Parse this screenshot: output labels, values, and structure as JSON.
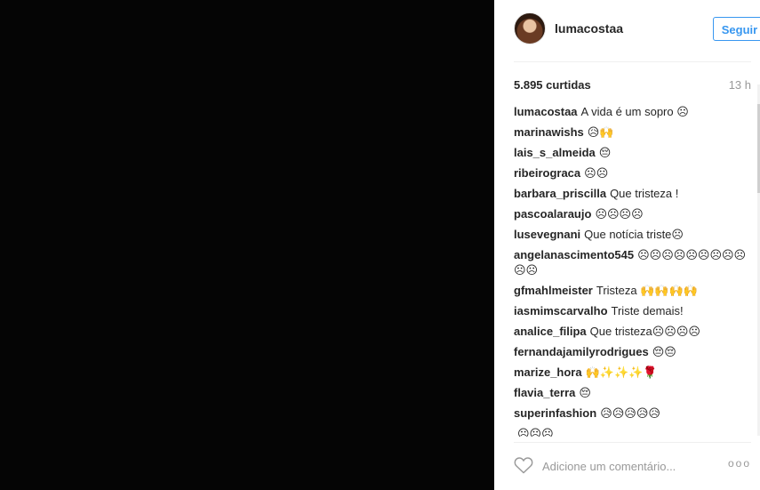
{
  "post": {
    "username": "lumacostaa",
    "follow_label": "Seguir",
    "likes": "5.895 curtidas",
    "time": "13 h"
  },
  "comments": [
    {
      "user": "lumacostaa",
      "text": "A vida é um sopro ☹"
    },
    {
      "user": "marinawishs",
      "text": "😥🙌"
    },
    {
      "user": "lais_s_almeida",
      "text": "😔"
    },
    {
      "user": "ribeirograca",
      "text": "☹☹"
    },
    {
      "user": "barbara_priscilla",
      "text": "Que tristeza !"
    },
    {
      "user": "pascoalaraujo",
      "text": "☹☹☹☹"
    },
    {
      "user": "lusevegnani",
      "text": "Que notícia triste☹"
    },
    {
      "user": "angelanascimento545",
      "text": "☹☹☹☹☹☹☹☹☹☹☹"
    },
    {
      "user": "gfmahlmeister",
      "text": "Tristeza 🙌🙌🙌🙌"
    },
    {
      "user": "iasmimscarvalho",
      "text": "Triste demais!"
    },
    {
      "user": "analice_filipa",
      "text": "Que tristeza☹☹☹☹"
    },
    {
      "user": "fernandajamilyrodrigues",
      "text": "😔😔"
    },
    {
      "user": "marize_hora",
      "text": "🙌✨✨✨🌹"
    },
    {
      "user": "flavia_terra",
      "text": "😔"
    },
    {
      "user": "superinfashion",
      "text": "😥😥😥😥😥"
    },
    {
      "user": "",
      "text": "☹☹☹"
    }
  ],
  "footer": {
    "comment_placeholder": "Adicione um comentário...",
    "more_label": "ooo"
  },
  "icons": {
    "like": "heart-outline",
    "more": "ellipsis"
  },
  "colors": {
    "accent": "#3897f0",
    "media_background": "#050505"
  }
}
